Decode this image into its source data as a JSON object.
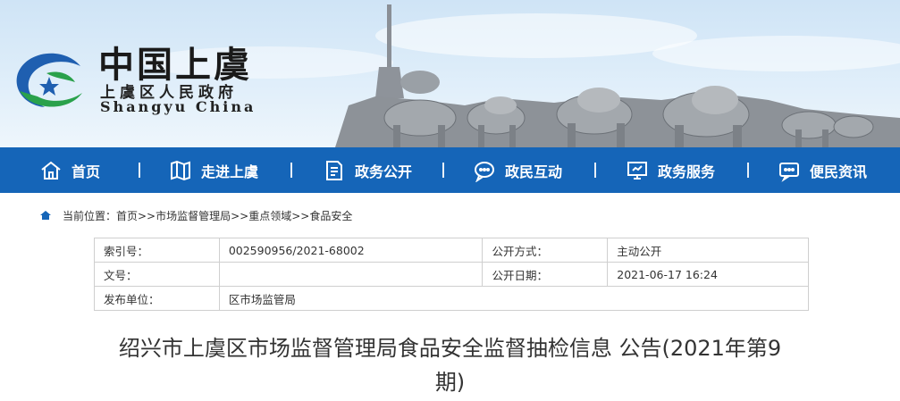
{
  "header": {
    "site_name": "中国上虞",
    "site_subname": "上虞区人民政府",
    "site_en": "Shangyu China",
    "colors": {
      "nav_bg": "#1565b8",
      "logo_blue": "#1f5fb0",
      "logo_green": "#2aa14b"
    }
  },
  "nav": {
    "items": [
      {
        "label": "首页",
        "icon": "home-icon"
      },
      {
        "label": "走进上虞",
        "icon": "map-icon"
      },
      {
        "label": "政务公开",
        "icon": "document-icon"
      },
      {
        "label": "政民互动",
        "icon": "chat-icon"
      },
      {
        "label": "政务服务",
        "icon": "monitor-icon"
      },
      {
        "label": "便民资讯",
        "icon": "message-icon"
      }
    ]
  },
  "breadcrumb": {
    "text": "当前位置：首页>>市场监督管理局>>重点领域>>食品安全"
  },
  "meta": {
    "index_label": "索引号：",
    "index_value": "002590956/2021-68002",
    "open_method_label": "公开方式：",
    "open_method_value": "主动公开",
    "doc_no_label": "文号：",
    "doc_no_value": "",
    "open_date_label": "公开日期：",
    "open_date_value": "2021-06-17 16:24",
    "publisher_label": "发布单位：",
    "publisher_value": "区市场监管局"
  },
  "article": {
    "title": "绍兴市上虞区市场监督管理局食品安全监督抽检信息 公告(2021年第9期)"
  }
}
